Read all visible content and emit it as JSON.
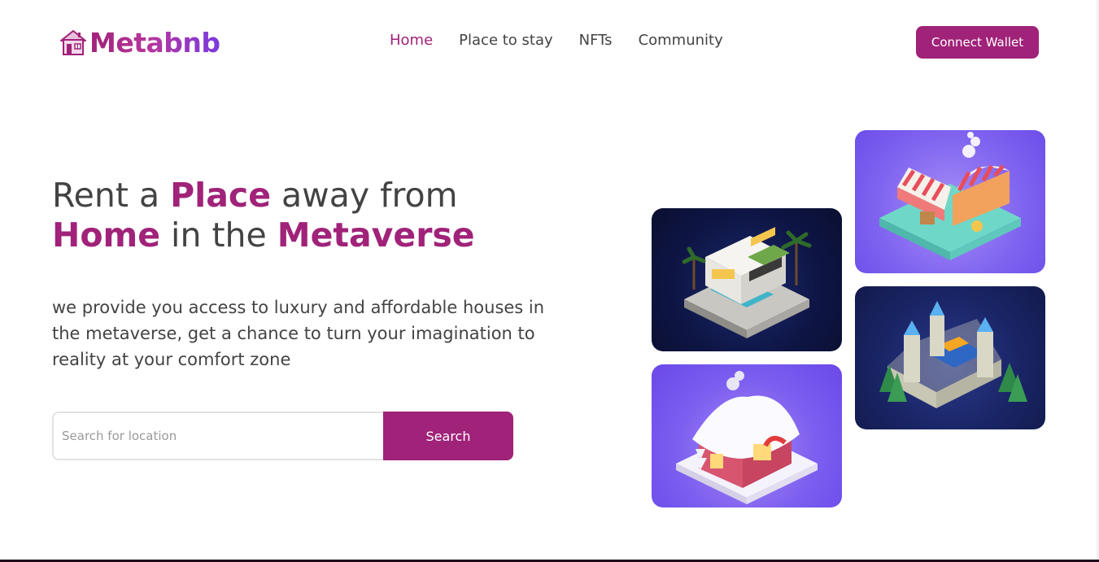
{
  "brand": {
    "name": "Metabnb",
    "icon": "house-icon"
  },
  "nav": {
    "items": [
      "Home",
      "Place to stay",
      "NFTs",
      "Community"
    ],
    "active": "Home"
  },
  "header": {
    "connect_label": "Connect Wallet"
  },
  "hero": {
    "title_parts": [
      "Rent a ",
      "Place",
      " away from ",
      "Home",
      " in the ",
      "Metaverse"
    ],
    "description": "we provide you access to luxury and affordable houses in the metaverse, get a chance to turn your imagination to reality at your comfort zone"
  },
  "search": {
    "placeholder": "Search for location",
    "button_label": "Search"
  },
  "colors": {
    "accent": "#a02279",
    "text": "#434343",
    "logo_gradient_end": "#7a3be0"
  }
}
